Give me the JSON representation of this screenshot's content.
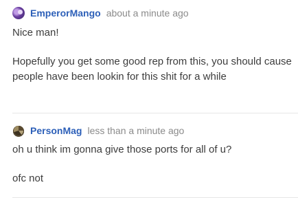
{
  "comments": [
    {
      "username": "EmperorMango",
      "timestamp": "about a minute ago",
      "avatar_icon": "user-avatar-purple",
      "paragraphs": [
        "Nice man!",
        "Hopefully you get some good rep from this, you should cause people have been lookin for this shit for a while"
      ]
    },
    {
      "username": "PersonMag",
      "timestamp": "less than a minute ago",
      "avatar_icon": "user-avatar-brown",
      "paragraphs": [
        "oh u think im gonna give those ports for all of u?",
        "ofc not"
      ]
    }
  ],
  "colors": {
    "username": "#2c5fb8",
    "timestamp": "#8a8a8a",
    "body_text": "#3c3c3c",
    "divider": "#e6e6e6"
  }
}
